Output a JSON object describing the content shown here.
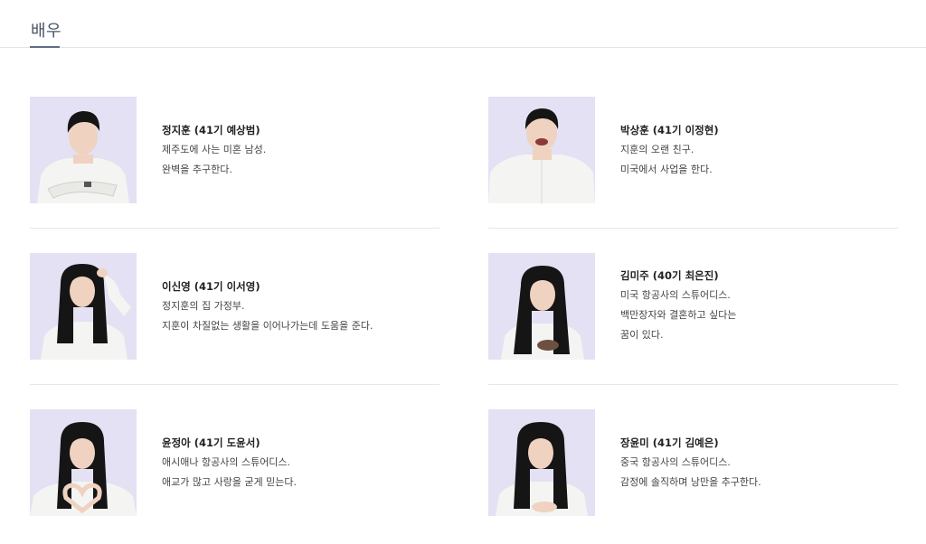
{
  "section": {
    "title": "배우"
  },
  "actors": [
    {
      "name": "정지훈 (41기 예상범)",
      "lines": [
        "제주도에 사는 미혼 남성.",
        "완벽을 추구한다."
      ],
      "gender": "male",
      "pose": "arms-crossed"
    },
    {
      "name": "박상훈 (41기 이정현)",
      "lines": [
        "지훈의 오랜 친구.",
        "미국에서 사업을 한다."
      ],
      "gender": "male",
      "pose": "laughing"
    },
    {
      "name": "이신영 (41기 이서영)",
      "lines": [
        "정지훈의 집 가정부.",
        "지훈이 차질없는 생활을 이어나가는데 도움을 준다."
      ],
      "gender": "female",
      "pose": "hand-on-head"
    },
    {
      "name": "김미주 (40기 최은진)",
      "lines": [
        "미국 항공사의 스튜어디스.",
        "백만장자와 결혼하고 싶다는",
        "꿈이 있다."
      ],
      "gender": "female",
      "pose": "hands-front"
    },
    {
      "name": "윤정아 (41기 도윤서)",
      "lines": [
        "애시애나 항공사의 스튜어디스.",
        "애교가 많고 사랑을 굳게 믿는다."
      ],
      "gender": "female",
      "pose": "heart-hands"
    },
    {
      "name": "장윤미 (41기 김예은)",
      "lines": [
        "중국 항공사의 스튜어디스.",
        "감정에 솔직하며 낭만을 추구한다."
      ],
      "gender": "female",
      "pose": "hands-chest"
    }
  ],
  "colors": {
    "photo_background": "#e3e1f3",
    "shirt": "#f4f4f2",
    "hair": "#151515",
    "skin": "#efd2c0",
    "title": "#4a5566"
  }
}
